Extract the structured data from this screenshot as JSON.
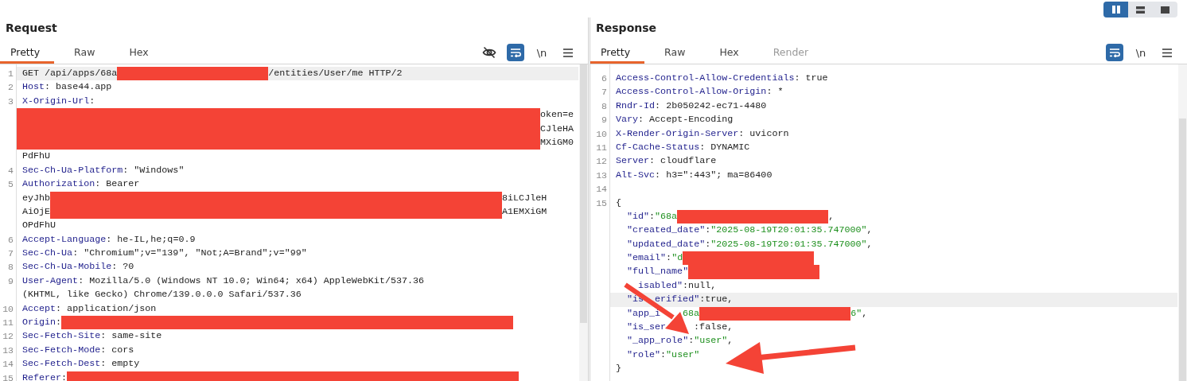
{
  "layout_toggle": [
    {
      "kind": "columns",
      "selected": true
    },
    {
      "kind": "rows",
      "selected": false
    },
    {
      "kind": "single",
      "selected": false
    }
  ],
  "panels": [
    {
      "title": "Request",
      "tabs": [
        {
          "label": "Pretty",
          "selected": true,
          "disabled": false
        },
        {
          "label": "Raw",
          "selected": false,
          "disabled": false
        },
        {
          "label": "Hex",
          "selected": false,
          "disabled": false
        }
      ],
      "toolbar": [
        {
          "kind": "hide"
        },
        {
          "kind": "wrap",
          "on": true
        },
        {
          "kind": "newline",
          "label": "\\n"
        },
        {
          "kind": "menu"
        }
      ],
      "rows": [
        {
          "num": "1",
          "highlighted": true,
          "segments": [
            {
              "kind": "text",
              "text": "GET /api/apps/68a"
            },
            {
              "kind": "redactmedium"
            },
            {
              "kind": "text",
              "text": "/entities/User/me HTTP/2"
            }
          ]
        },
        {
          "num": "2",
          "highlighted": false,
          "segments": [
            {
              "kind": "key",
              "text": "Host"
            },
            {
              "kind": "text",
              "text": ": base44.app"
            }
          ]
        },
        {
          "num": "3",
          "highlighted": false,
          "segments": [
            {
              "kind": "key",
              "text": "X-Origin-Url"
            },
            {
              "kind": "text",
              "text": ":"
            }
          ]
        },
        {
          "highlighted": false,
          "segments": [
            {
              "kind": "redactfill"
            },
            {
              "kind": "text",
              "text": "oken=e"
            }
          ]
        },
        {
          "highlighted": false,
          "segments": [
            {
              "kind": "redactfill"
            },
            {
              "kind": "text",
              "text": "CJleHA"
            }
          ]
        },
        {
          "highlighted": false,
          "segments": [
            {
              "kind": "redactfill"
            },
            {
              "kind": "text",
              "text": "MXiGM0"
            }
          ]
        },
        {
          "highlighted": false,
          "segments": [
            {
              "kind": "text",
              "text": "PdFhU"
            }
          ]
        },
        {
          "num": "4",
          "highlighted": false,
          "segments": [
            {
              "kind": "key",
              "text": "Sec-Ch-Ua-Platform"
            },
            {
              "kind": "text",
              "text": ": \"Windows\""
            }
          ]
        },
        {
          "num": "5",
          "highlighted": false,
          "segments": [
            {
              "kind": "key",
              "text": "Authorization"
            },
            {
              "kind": "text",
              "text": ": Bearer"
            }
          ]
        },
        {
          "highlighted": false,
          "segments": [
            {
              "kind": "text",
              "text": "eyJhb"
            },
            {
              "kind": "redactlong"
            },
            {
              "kind": "text",
              "text": "8iLCJleH"
            }
          ]
        },
        {
          "highlighted": false,
          "segments": [
            {
              "kind": "text",
              "text": "AiOjE"
            },
            {
              "kind": "redactlong"
            },
            {
              "kind": "text",
              "text": "A1EMXiGM"
            }
          ]
        },
        {
          "highlighted": false,
          "segments": [
            {
              "kind": "text",
              "text": "OPdFhU"
            }
          ]
        },
        {
          "num": "6",
          "highlighted": false,
          "segments": [
            {
              "kind": "key",
              "text": "Accept-Language"
            },
            {
              "kind": "text",
              "text": ": he-IL,he;q=0.9"
            }
          ]
        },
        {
          "num": "7",
          "highlighted": false,
          "segments": [
            {
              "kind": "key",
              "text": "Sec-Ch-Ua"
            },
            {
              "kind": "text",
              "text": ": \"Chromium\";v=\"139\", \"Not;A=Brand\";v=\"99\""
            }
          ]
        },
        {
          "num": "8",
          "highlighted": false,
          "segments": [
            {
              "kind": "key",
              "text": "Sec-Ch-Ua-Mobile"
            },
            {
              "kind": "text",
              "text": ": ?0"
            }
          ]
        },
        {
          "num": "9",
          "highlighted": false,
          "segments": [
            {
              "kind": "key",
              "text": "User-Agent"
            },
            {
              "kind": "text",
              "text": ": Mozilla/5.0 (Windows NT 10.0; Win64; x64) AppleWebKit/537.36"
            }
          ]
        },
        {
          "highlighted": false,
          "segments": [
            {
              "kind": "text",
              "text": "(KHTML, like Gecko) Chrome/139.0.0.0 Safari/537.36"
            }
          ]
        },
        {
          "num": "10",
          "highlighted": false,
          "segments": [
            {
              "kind": "key",
              "text": "Accept"
            },
            {
              "kind": "text",
              "text": ": application/json"
            }
          ]
        },
        {
          "num": "11",
          "highlighted": false,
          "segments": [
            {
              "kind": "key",
              "text": "Origin"
            },
            {
              "kind": "text",
              "text": ":"
            },
            {
              "kind": "redactlong"
            }
          ]
        },
        {
          "num": "12",
          "highlighted": false,
          "segments": [
            {
              "kind": "key",
              "text": "Sec-Fetch-Site"
            },
            {
              "kind": "text",
              "text": ": same-site"
            }
          ]
        },
        {
          "num": "13",
          "highlighted": false,
          "segments": [
            {
              "kind": "key",
              "text": "Sec-Fetch-Mode"
            },
            {
              "kind": "text",
              "text": ": cors"
            }
          ]
        },
        {
          "num": "14",
          "highlighted": false,
          "segments": [
            {
              "kind": "key",
              "text": "Sec-Fetch-Dest"
            },
            {
              "kind": "text",
              "text": ": empty"
            }
          ]
        },
        {
          "num": "15",
          "highlighted": false,
          "segments": [
            {
              "kind": "key",
              "text": "Referer"
            },
            {
              "kind": "text",
              "text": ":"
            },
            {
              "kind": "redactlong"
            }
          ]
        }
      ]
    },
    {
      "title": "Response",
      "tabs": [
        {
          "label": "Pretty",
          "selected": true,
          "disabled": false
        },
        {
          "label": "Raw",
          "selected": false,
          "disabled": false
        },
        {
          "label": "Hex",
          "selected": false,
          "disabled": false
        },
        {
          "label": "Render",
          "selected": false,
          "disabled": true
        }
      ],
      "toolbar": [
        {
          "kind": "wrap",
          "on": true
        },
        {
          "kind": "newline",
          "label": "\\n"
        },
        {
          "kind": "menu"
        }
      ],
      "rows": [
        {
          "num": "6",
          "highlighted": false,
          "segments": [
            {
              "kind": "key",
              "text": "Access-Control-Allow-Credentials"
            },
            {
              "kind": "text",
              "text": ": true"
            }
          ]
        },
        {
          "num": "7",
          "highlighted": false,
          "segments": [
            {
              "kind": "key",
              "text": "Access-Control-Allow-Origin"
            },
            {
              "kind": "text",
              "text": ": *"
            }
          ]
        },
        {
          "num": "8",
          "highlighted": false,
          "segments": [
            {
              "kind": "key",
              "text": "Rndr-Id"
            },
            {
              "kind": "text",
              "text": ": 2b050242-ec71-4480"
            }
          ]
        },
        {
          "num": "9",
          "highlighted": false,
          "segments": [
            {
              "kind": "key",
              "text": "Vary"
            },
            {
              "kind": "text",
              "text": ": Accept-Encoding"
            }
          ]
        },
        {
          "num": "10",
          "highlighted": false,
          "segments": [
            {
              "kind": "key",
              "text": "X-Render-Origin-Server"
            },
            {
              "kind": "text",
              "text": ": uvicorn"
            }
          ]
        },
        {
          "num": "11",
          "highlighted": false,
          "segments": [
            {
              "kind": "key",
              "text": "Cf-Cache-Status"
            },
            {
              "kind": "text",
              "text": ": DYNAMIC"
            }
          ]
        },
        {
          "num": "12",
          "highlighted": false,
          "segments": [
            {
              "kind": "key",
              "text": "Server"
            },
            {
              "kind": "text",
              "text": ": cloudflare"
            }
          ]
        },
        {
          "num": "13",
          "highlighted": false,
          "segments": [
            {
              "kind": "key",
              "text": "Alt-Svc"
            },
            {
              "kind": "text",
              "text": ": h3=\":443\"; ma=86400"
            }
          ]
        },
        {
          "num": "14",
          "highlighted": false
        },
        {
          "num": "15",
          "highlighted": false,
          "segments": [
            {
              "kind": "text",
              "text": "{"
            }
          ],
          "children": [
            {
              "highlighted": false,
              "segments": [
                {
                  "kind": "key",
                  "text": "\"id\""
                },
                {
                  "kind": "text",
                  "text": ":"
                },
                {
                  "kind": "string",
                  "text": "\"68a"
                },
                {
                  "kind": "redactmedium"
                },
                {
                  "kind": "text",
                  "text": ","
                }
              ]
            },
            {
              "highlighted": false,
              "segments": [
                {
                  "kind": "key",
                  "text": "\"created_date\""
                },
                {
                  "kind": "text",
                  "text": ":"
                },
                {
                  "kind": "string",
                  "text": "\"2025-08-19T20:01:35.747000\""
                },
                {
                  "kind": "text",
                  "text": ","
                }
              ]
            },
            {
              "highlighted": false,
              "segments": [
                {
                  "kind": "key",
                  "text": "\"updated_date\""
                },
                {
                  "kind": "text",
                  "text": ":"
                },
                {
                  "kind": "string",
                  "text": "\"2025-08-19T20:01:35.747000\""
                },
                {
                  "kind": "text",
                  "text": ","
                }
              ]
            },
            {
              "highlighted": false,
              "segments": [
                {
                  "kind": "key",
                  "text": "\"email\""
                },
                {
                  "kind": "text",
                  "text": ":"
                },
                {
                  "kind": "string",
                  "text": "\"d"
                },
                {
                  "kind": "redactshort"
                }
              ]
            },
            {
              "highlighted": false,
              "segments": [
                {
                  "kind": "key",
                  "text": "\"full_name\""
                },
                {
                  "kind": "redactshort"
                }
              ]
            },
            {
              "highlighted": false,
              "segments": [
                {
                  "kind": "hidden"
                },
                {
                  "kind": "hidden"
                },
                {
                  "kind": "key",
                  "text": "isabled\""
                },
                {
                  "kind": "text",
                  "text": ":null,"
                }
              ]
            },
            {
              "highlighted": true,
              "segments": [
                {
                  "kind": "key",
                  "text": "\"is"
                },
                {
                  "kind": "hidden"
                },
                {
                  "kind": "hidden"
                },
                {
                  "kind": "key",
                  "text": "erified\""
                },
                {
                  "kind": "text",
                  "text": ":true,"
                }
              ]
            },
            {
              "highlighted": false,
              "segments": [
                {
                  "kind": "key",
                  "text": "\"app_i"
                },
                {
                  "kind": "hidden"
                },
                {
                  "kind": "hidden"
                },
                {
                  "kind": "hidden"
                },
                {
                  "kind": "hidden"
                },
                {
                  "kind": "string",
                  "text": "68a"
                },
                {
                  "kind": "redactmedium"
                },
                {
                  "kind": "string",
                  "text": "6\""
                },
                {
                  "kind": "text",
                  "text": ","
                }
              ]
            },
            {
              "highlighted": false,
              "segments": [
                {
                  "kind": "key",
                  "text": "\"is_ser"
                },
                {
                  "kind": "hidden"
                },
                {
                  "kind": "hidden"
                },
                {
                  "kind": "hidden"
                },
                {
                  "kind": "hidden"
                },
                {
                  "kind": "hidden"
                },
                {
                  "kind": "text",
                  "text": ":false,"
                }
              ]
            },
            {
              "highlighted": false,
              "segments": [
                {
                  "kind": "key",
                  "text": "\"_app_role\""
                },
                {
                  "kind": "text",
                  "text": ":"
                },
                {
                  "kind": "string",
                  "text": "\"user\""
                },
                {
                  "kind": "text",
                  "text": ","
                }
              ]
            },
            {
              "highlighted": false,
              "segments": [
                {
                  "kind": "key",
                  "text": "\"role\""
                },
                {
                  "kind": "text",
                  "text": ":"
                },
                {
                  "kind": "string",
                  "text": "\"user\""
                }
              ]
            }
          ]
        },
        {
          "highlighted": false,
          "segments": [
            {
              "kind": "text",
              "text": "}"
            }
          ]
        }
      ]
    }
  ]
}
